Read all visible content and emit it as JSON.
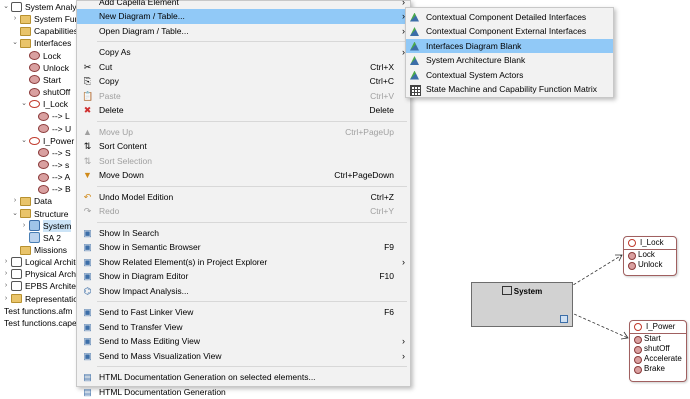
{
  "tree": {
    "rows": [
      {
        "label": "System Analys",
        "level": 0,
        "toggle": "expanded",
        "icon": "grid-icon"
      },
      {
        "label": "System Fun",
        "level": 1,
        "toggle": "collapsed",
        "icon": "folder-icon"
      },
      {
        "label": "Capabilities",
        "level": 1,
        "toggle": "",
        "icon": "folder-icon"
      },
      {
        "label": "Interfaces",
        "level": 1,
        "toggle": "expanded",
        "icon": "folder-icon"
      },
      {
        "label": "Lock",
        "level": 2,
        "toggle": "",
        "icon": "exchange-icon"
      },
      {
        "label": "Unlock",
        "level": 2,
        "toggle": "",
        "icon": "exchange-icon"
      },
      {
        "label": "Start",
        "level": 2,
        "toggle": "",
        "icon": "exchange-icon"
      },
      {
        "label": "shutOff",
        "level": 2,
        "toggle": "",
        "icon": "exchange-icon"
      },
      {
        "label": "I_Lock",
        "level": 2,
        "toggle": "expanded",
        "icon": "interface-icon"
      },
      {
        "label": "--> L",
        "level": 3,
        "toggle": "",
        "icon": "exchange-icon"
      },
      {
        "label": "--> U",
        "level": 3,
        "toggle": "",
        "icon": "exchange-icon"
      },
      {
        "label": "I_Power",
        "level": 2,
        "toggle": "expanded",
        "icon": "interface-icon"
      },
      {
        "label": "--> S",
        "level": 3,
        "toggle": "",
        "icon": "exchange-icon"
      },
      {
        "label": "--> s",
        "level": 3,
        "toggle": "",
        "icon": "exchange-icon"
      },
      {
        "label": "--> A",
        "level": 3,
        "toggle": "",
        "icon": "exchange-icon"
      },
      {
        "label": "--> B",
        "level": 3,
        "toggle": "",
        "icon": "exchange-icon"
      },
      {
        "label": "Data",
        "level": 1,
        "toggle": "collapsed",
        "icon": "folder-icon"
      },
      {
        "label": "Structure",
        "level": 1,
        "toggle": "expanded",
        "icon": "folder-icon"
      },
      {
        "label": "System",
        "level": 2,
        "toggle": "collapsed",
        "icon": "system-icon",
        "selected": true
      },
      {
        "label": "SA 2",
        "level": 2,
        "toggle": "",
        "icon": "diagram-icon"
      },
      {
        "label": "Missions",
        "level": 1,
        "toggle": "",
        "icon": "folder-icon"
      },
      {
        "label": "Logical Archite",
        "level": 0,
        "toggle": "collapsed",
        "icon": "grid-icon"
      },
      {
        "label": "Physical Archi",
        "level": 0,
        "toggle": "collapsed",
        "icon": "grid-icon"
      },
      {
        "label": "EPBS Architect",
        "level": 0,
        "toggle": "collapsed",
        "icon": "grid-icon"
      },
      {
        "label": "Representations p",
        "level": 0,
        "toggle": "collapsed",
        "icon": "folder-icon"
      },
      {
        "label": "Test functions.afm",
        "level": -1,
        "toggle": "",
        "icon": ""
      },
      {
        "label": "Test functions.capell",
        "level": -1,
        "toggle": "",
        "icon": ""
      }
    ]
  },
  "menu": {
    "items": [
      {
        "label": "Add Capella Element",
        "accel": "",
        "submenu": true,
        "icon": "",
        "disabled": false
      },
      {
        "label": "New Diagram / Table...",
        "accel": "",
        "submenu": true,
        "icon": "",
        "highlighted": true
      },
      {
        "label": "Open Diagram / Table...",
        "accel": "",
        "submenu": true,
        "icon": ""
      },
      {
        "sep": true
      },
      {
        "label": "Copy As",
        "accel": "",
        "submenu": true,
        "icon": ""
      },
      {
        "label": "Cut",
        "accel": "Ctrl+X",
        "icon": "✂",
        "iconName": "cut-icon"
      },
      {
        "label": "Copy",
        "accel": "Ctrl+C",
        "icon": "⎘",
        "iconName": "copy-icon"
      },
      {
        "label": "Paste",
        "accel": "Ctrl+V",
        "icon": "📋",
        "iconName": "paste-icon",
        "disabled": true
      },
      {
        "label": "Delete",
        "accel": "Delete",
        "icon": "✖",
        "iconName": "delete-icon",
        "iconColor": "#d03030"
      },
      {
        "sep": true
      },
      {
        "label": "Move Up",
        "accel": "Ctrl+PageUp",
        "icon": "▲",
        "iconName": "move-up-icon",
        "disabled": true
      },
      {
        "label": "Sort Content",
        "accel": "",
        "icon": "⇅",
        "iconName": "sort-content-icon"
      },
      {
        "label": "Sort Selection",
        "accel": "",
        "icon": "⇅",
        "iconName": "sort-selection-icon",
        "disabled": true
      },
      {
        "label": "Move Down",
        "accel": "Ctrl+PageDown",
        "icon": "▼",
        "iconName": "move-down-icon",
        "iconColor": "#d08a1a"
      },
      {
        "sep": true
      },
      {
        "label": "Undo Model Edition",
        "accel": "Ctrl+Z",
        "icon": "↶",
        "iconName": "undo-icon",
        "iconColor": "#d08a1a"
      },
      {
        "label": "Redo",
        "accel": "Ctrl+Y",
        "icon": "↷",
        "iconName": "redo-icon",
        "disabled": true
      },
      {
        "sep": true
      },
      {
        "label": "Show In Search",
        "accel": "",
        "icon": "▣",
        "iconName": "search-view-icon",
        "iconColor": "#3c6ea8"
      },
      {
        "label": "Show in Semantic Browser",
        "accel": "F9",
        "icon": "▣",
        "iconName": "semantic-browser-icon",
        "iconColor": "#3c6ea8"
      },
      {
        "label": "Show Related Element(s) in Project Explorer",
        "accel": "",
        "submenu": true,
        "icon": "▣",
        "iconName": "project-explorer-icon",
        "iconColor": "#3c6ea8"
      },
      {
        "label": "Show in Diagram Editor",
        "accel": "F10",
        "icon": "▣",
        "iconName": "diagram-editor-icon",
        "iconColor": "#3c6ea8"
      },
      {
        "label": "Show Impact Analysis...",
        "accel": "",
        "icon": "⌬",
        "iconName": "impact-analysis-icon",
        "iconColor": "#3c6ea8"
      },
      {
        "sep": true
      },
      {
        "label": "Send to Fast Linker View",
        "accel": "F6",
        "icon": "▣",
        "iconName": "fast-linker-icon",
        "iconColor": "#3c6ea8"
      },
      {
        "label": "Send to Transfer View",
        "accel": "",
        "icon": "▣",
        "iconName": "transfer-view-icon",
        "iconColor": "#3c6ea8"
      },
      {
        "label": "Send to Mass Editing View",
        "accel": "",
        "submenu": true,
        "icon": "▣",
        "iconName": "mass-editing-icon",
        "iconColor": "#3c6ea8"
      },
      {
        "label": "Send to Mass Visualization View",
        "accel": "",
        "submenu": true,
        "icon": "▣",
        "iconName": "mass-visualization-icon",
        "iconColor": "#3c6ea8"
      },
      {
        "sep": true
      },
      {
        "label": "HTML Documentation Generation on selected elements...",
        "accel": "",
        "icon": "▤",
        "iconName": "html-doc-icon",
        "iconColor": "#3c6ea8"
      },
      {
        "label": "HTML Documentation Generation",
        "accel": "",
        "icon": "▤",
        "iconName": "html-doc-icon",
        "iconColor": "#3c6ea8"
      }
    ]
  },
  "submenu": {
    "items": [
      {
        "label": "Contextual Component Detailed Interfaces",
        "icon": "diagram-icon"
      },
      {
        "label": "Contextual Component External Interfaces",
        "icon": "diagram-icon"
      },
      {
        "label": "Interfaces Diagram Blank",
        "icon": "diagram-icon",
        "highlighted": true
      },
      {
        "label": "System Architecture Blank",
        "icon": "diagram-icon"
      },
      {
        "label": "Contextual System Actors",
        "icon": "diagram-icon"
      },
      {
        "label": "State Machine and Capability Function Matrix",
        "icon": "matrix-icon"
      }
    ]
  },
  "diagram": {
    "system_title": "System",
    "interfaces": [
      {
        "name": "I_Lock",
        "exchanges": [
          "Lock",
          "Unlock"
        ]
      },
      {
        "name": "I_Power",
        "exchanges": [
          "Start",
          "shutOff",
          "Accelerate",
          "Brake"
        ]
      }
    ]
  },
  "colors": {
    "menu_bg": "#f2f2f2",
    "highlight": "#91c9f7",
    "disabled_text": "#a0a0a0",
    "system_fill": "#d2d2d2",
    "interface_border": "#a06060"
  }
}
